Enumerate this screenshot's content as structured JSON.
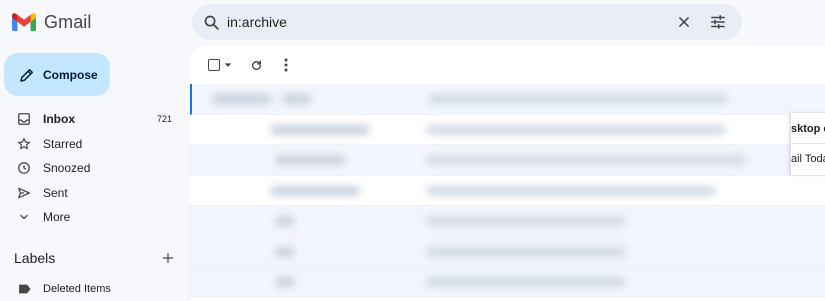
{
  "app": {
    "name": "Gmail",
    "brand_colors": [
      "#4285f4",
      "#ea4335",
      "#fbbc04",
      "#34a853",
      "#c5221f"
    ]
  },
  "search": {
    "value": "in:archive",
    "icons": [
      "search-icon",
      "close-icon",
      "tune-icon"
    ]
  },
  "compose": {
    "label": "Compose",
    "icon": "pencil-icon",
    "background": "#c2e7ff"
  },
  "nav": {
    "items": [
      {
        "label": "Inbox",
        "count": "721",
        "icon": "inbox-icon",
        "bold": true
      },
      {
        "label": "Starred",
        "icon": "star-icon"
      },
      {
        "label": "Snoozed",
        "icon": "clock-icon"
      },
      {
        "label": "Sent",
        "icon": "send-icon"
      },
      {
        "label": "More",
        "icon": "chevron-down-icon"
      }
    ]
  },
  "labels": {
    "title": "Labels",
    "add_icon": "plus-icon",
    "items": [
      {
        "label": "Deleted Items",
        "icon": "label-icon"
      }
    ]
  },
  "toolbar": {
    "icons": [
      "checkbox-icon",
      "dropdown-arrow-icon",
      "refresh-icon",
      "more-vert-icon"
    ]
  },
  "list": {
    "rows": [
      "unread",
      "read",
      "unread",
      "read",
      "unread",
      "unread",
      "unread"
    ],
    "first_row_accent": "#1a73e8"
  },
  "peek": {
    "line1": "sktop c",
    "line2": "ail Toda"
  }
}
